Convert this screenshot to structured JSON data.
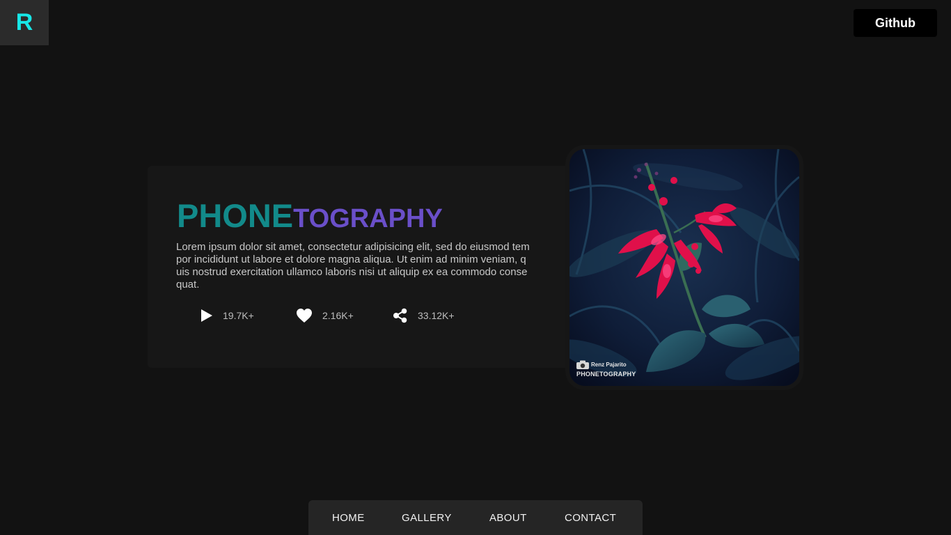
{
  "logo": {
    "letter": "R",
    "color": "#17e6e6"
  },
  "header": {
    "github_label": "Github"
  },
  "hero": {
    "title_part1": "PHONE",
    "title_part2": "TOGRAPHY",
    "title_colors": [
      "#128a8a",
      "#6a4fc9"
    ],
    "description": "Lorem ipsum dolor sit amet, consectetur adipisicing elit, sed do eiusmod tempor incididunt ut labore et dolore magna aliqua. Ut enim ad minim veniam, quis nostrud exercitation ullamco laboris nisi ut aliquip ex ea commodo consequat.",
    "stats": [
      {
        "icon": "play-icon",
        "value": "19.7K+"
      },
      {
        "icon": "heart-icon",
        "value": "2.16K+"
      },
      {
        "icon": "share-icon",
        "value": "33.12K+"
      }
    ]
  },
  "photo": {
    "subject": "red-flower-photo",
    "watermark_name": "Renz Pajarito",
    "watermark_brand": "PHONETOGRAPHY"
  },
  "nav": {
    "items": [
      "HOME",
      "GALLERY",
      "ABOUT",
      "CONTACT"
    ]
  },
  "colors": {
    "background": "#121212",
    "card": "#171717",
    "nav": "#252525"
  }
}
